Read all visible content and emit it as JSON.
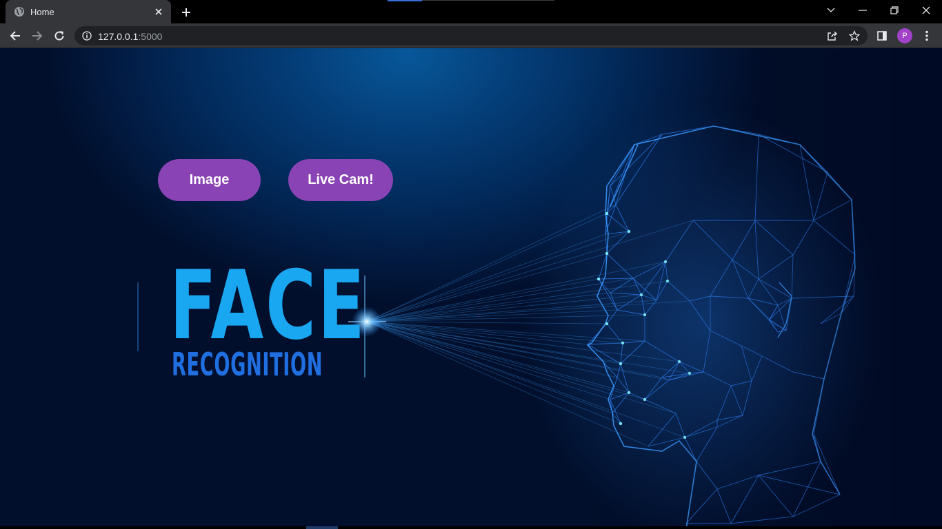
{
  "browser": {
    "tab_title": "Home",
    "url_host": "127.0.0.1",
    "url_port": ":5000",
    "profile_initial": "P",
    "icons": {
      "favicon": "globe-icon",
      "tab_close": "close-icon",
      "new_tab": "plus-icon",
      "tab_search": "chevron-down-icon",
      "minimize": "minimize-icon",
      "restore": "restore-icon",
      "close_window": "close-icon",
      "back": "arrow-left-icon",
      "forward": "arrow-right-icon",
      "reload": "reload-icon",
      "site_info": "info-icon",
      "share": "share-icon",
      "bookmark": "star-icon",
      "side_panel": "side-panel-icon",
      "menu": "kebab-menu-icon"
    }
  },
  "page": {
    "buttons": {
      "image": "Image",
      "live_cam": "Live Cam!"
    },
    "hero": {
      "title": "FACE",
      "subtitle": "RECOGNITION",
      "illustration": "wireframe-head-illustration"
    },
    "colors": {
      "button_bg": "#8a43b4",
      "title": "#1aa7f2",
      "subtitle": "#1f6fe0",
      "background": "#022a5b"
    }
  }
}
